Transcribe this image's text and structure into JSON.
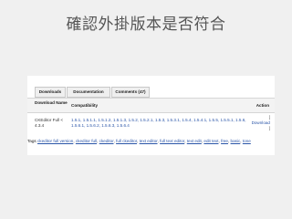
{
  "slide_title": "確認外掛版本是否符合",
  "tabs": [
    "Downloads",
    "Documentation",
    "Comments (47)"
  ],
  "table": {
    "headers": {
      "name": "Download Name",
      "compatibility": "Compatibility",
      "action": "Action"
    },
    "row": {
      "name": "CKEditor Full < 4.3.4",
      "versions": "1.5.1, 1.5.1.1, 1.5.1.2, 1.5.1.3, 1.5.2, 1.5.2.1, 1.5.3, 1.5.3.1, 1.5.4, 1.5.4.1, 1.5.5, 1.5.5.1, 1.5.6, 1.5.6.1, 1.5.6.2, 1.5.6.3, 1.5.6.4",
      "bracket_open": "[",
      "action": "Download",
      "bracket_close": "]"
    }
  },
  "tags": {
    "label": "Tags",
    "items": [
      "ckeditor full version",
      "ckeditor full",
      "ckeditor",
      "full ckeditor",
      "text editor",
      "full text editor",
      "text edit",
      "edit text",
      "free",
      "basic",
      "tone"
    ]
  }
}
